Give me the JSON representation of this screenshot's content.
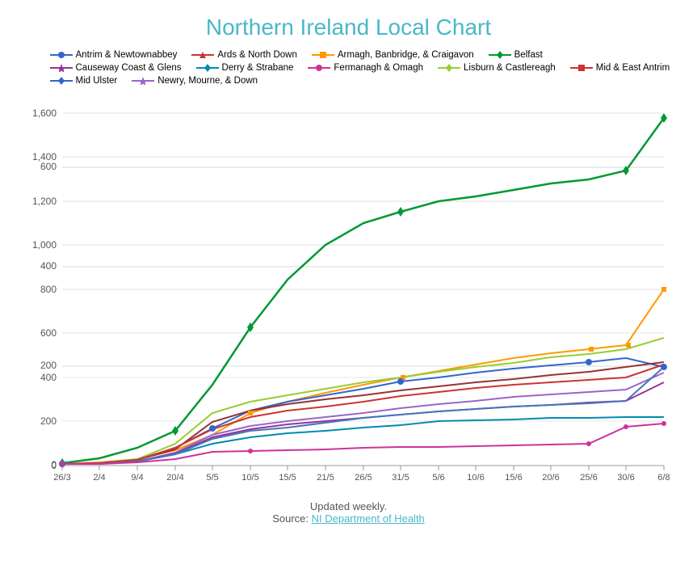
{
  "title": "Northern Ireland Local Chart",
  "legend": [
    {
      "label": "Antrim & Newtownabbey",
      "color": "#3366cc",
      "shape": "circle"
    },
    {
      "label": "Ards & North Down",
      "color": "#cc3333",
      "shape": "arrow"
    },
    {
      "label": "Armagh, Banbridge, & Craigavon",
      "color": "#ff9900",
      "shape": "square"
    },
    {
      "label": "Belfast",
      "color": "#009933",
      "shape": "diamond"
    },
    {
      "label": "Causeway Coast & Glens",
      "color": "#993399",
      "shape": "star"
    },
    {
      "label": "Derry & Strabane",
      "color": "#008bb0",
      "shape": "diamond"
    },
    {
      "label": "Fermanagh & Omagh",
      "color": "#cc3399",
      "shape": "circle"
    },
    {
      "label": "Lisburn & Castlereagh",
      "color": "#99cc33",
      "shape": "diamond"
    },
    {
      "label": "Mid & East Antrim",
      "color": "#cc3333",
      "shape": "square"
    },
    {
      "label": "Mid Ulster",
      "color": "#3366cc",
      "shape": "diamond"
    },
    {
      "label": "Newry, Mourne, & Down",
      "color": "#9966cc",
      "shape": "star"
    }
  ],
  "xLabels": [
    "26/3",
    "2/4",
    "9/4",
    "20/4",
    "5/5",
    "10/5",
    "15/5",
    "21/5",
    "26/5",
    "31/5",
    "5/6",
    "10/6",
    "15/6",
    "20/6",
    "25/6",
    "30/6",
    "6/8"
  ],
  "yLabels": [
    "0",
    "200",
    "400",
    "600",
    "800",
    "1,000",
    "1,200",
    "1,400",
    "1,600"
  ],
  "footer": {
    "updated": "Updated weekly.",
    "source_prefix": "Source: ",
    "source_link": "NI Department of Health"
  }
}
